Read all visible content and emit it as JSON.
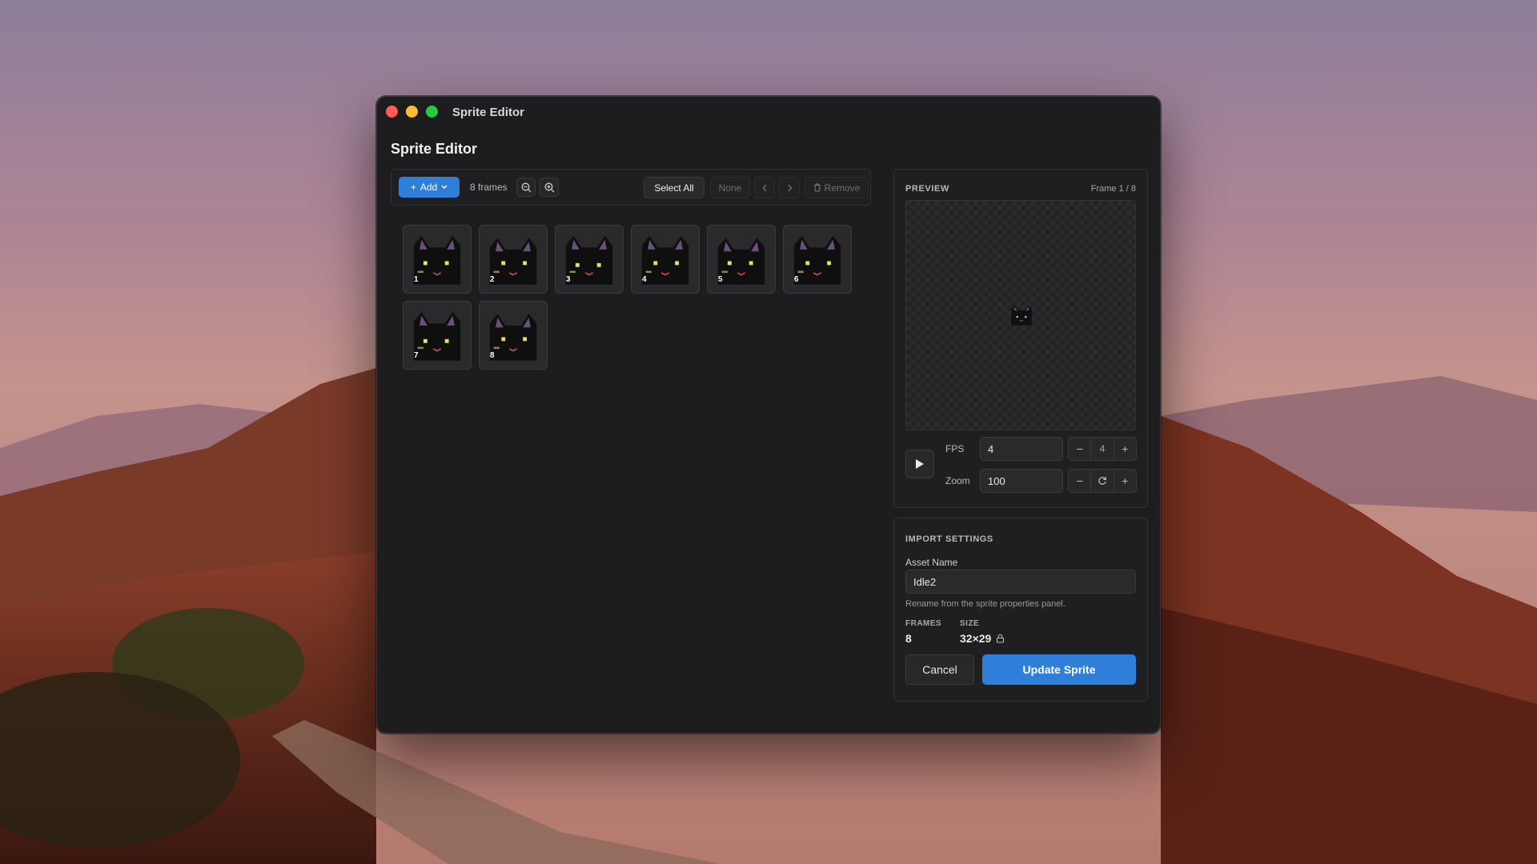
{
  "window": {
    "title": "Sprite Editor",
    "heading": "Sprite Editor"
  },
  "toolbar": {
    "add_label": "Add",
    "frames_count": "8 frames",
    "select_all": "Select All",
    "none": "None",
    "remove": "Remove"
  },
  "frames": [
    "1",
    "2",
    "3",
    "4",
    "5",
    "6",
    "7",
    "8"
  ],
  "preview": {
    "label": "PREVIEW",
    "frame_info": "Frame 1 / 8",
    "fps_label": "FPS",
    "fps_value": "4",
    "fps_stepper_value": "4",
    "zoom_label": "Zoom",
    "zoom_value": "100"
  },
  "import": {
    "label": "IMPORT SETTINGS",
    "asset_name_label": "Asset Name",
    "asset_name": "Idle2",
    "hint": "Rename from the sprite properties panel.",
    "frames_label": "FRAMES",
    "frames_value": "8",
    "size_label": "SIZE",
    "size_value": "32×29",
    "cancel": "Cancel",
    "update": "Update Sprite"
  },
  "colors": {
    "accent": "#2f7fd9",
    "window_bg": "#1d1d1f",
    "close": "#ff5f57",
    "minimize": "#febc2e",
    "maximize": "#28c840"
  }
}
